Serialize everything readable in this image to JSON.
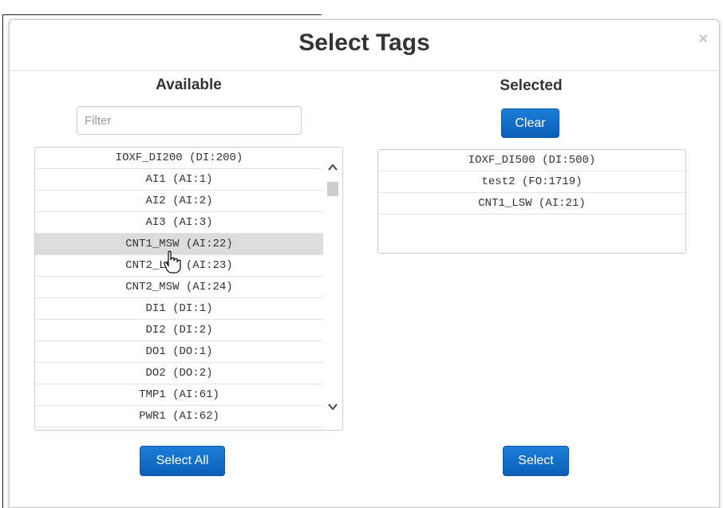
{
  "modal": {
    "title": "Select Tags",
    "close_label": "×"
  },
  "available": {
    "title": "Available",
    "filter_placeholder": "Filter",
    "items": [
      "IOXF_DI200 (DI:200)",
      "AI1 (AI:1)",
      "AI2 (AI:2)",
      "AI3 (AI:3)",
      "CNT1_MSW (AI:22)",
      "CNT2_LSW (AI:23)",
      "CNT2_MSW (AI:24)",
      "DI1 (DI:1)",
      "DI2 (DI:2)",
      "DO1 (DO:1)",
      "DO2 (DO:2)",
      "TMP1 (AI:61)",
      "PWR1 (AI:62)"
    ],
    "highlighted_index": 4,
    "select_all_label": "Select All"
  },
  "selected": {
    "title": "Selected",
    "clear_label": "Clear",
    "items": [
      "IOXF_DI500 (DI:500)",
      "test2 (FO:1719)",
      "CNT1_LSW (AI:21)"
    ],
    "select_label": "Select"
  },
  "icons": {
    "close": "close-icon",
    "scroll_up": "chevron-up-icon",
    "scroll_down": "chevron-down-icon",
    "cursor": "hand-pointer-icon"
  },
  "colors": {
    "primary_button": "#0a6fcf",
    "highlight_row": "#dcdcdc"
  }
}
